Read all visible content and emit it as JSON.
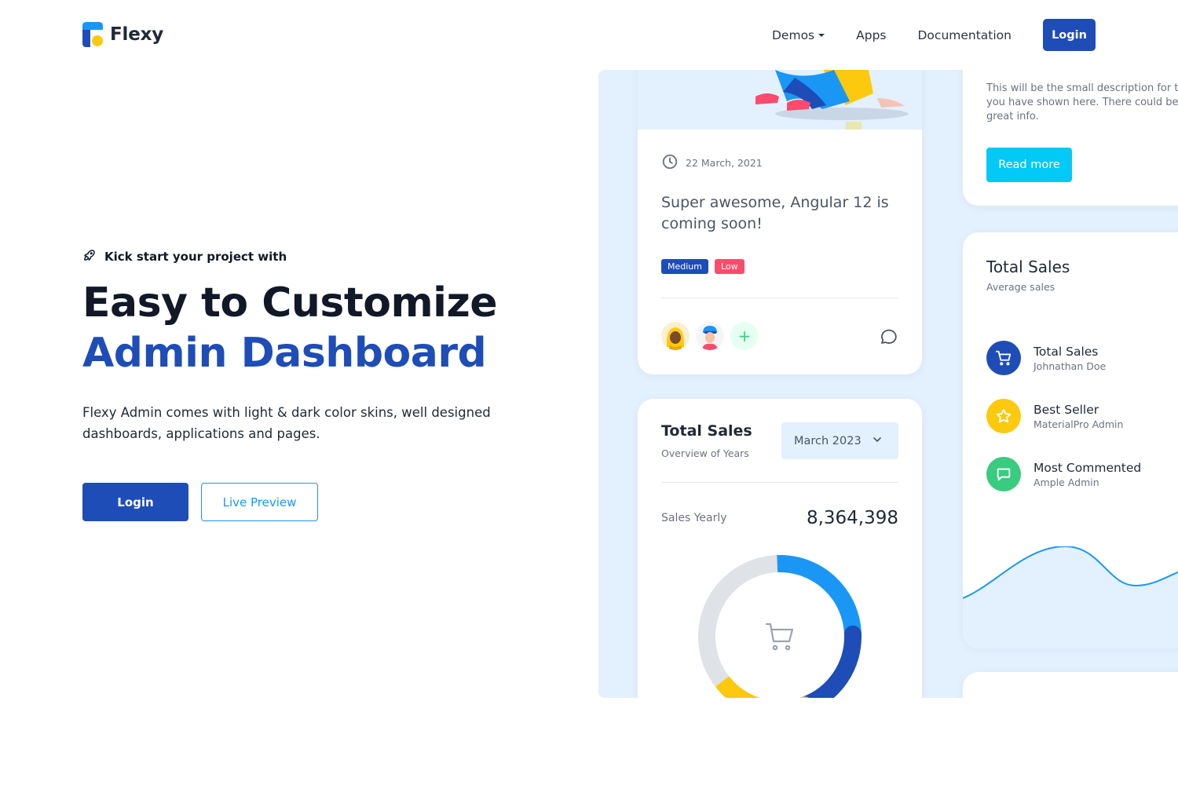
{
  "brand": {
    "name": "Flexy"
  },
  "nav": {
    "demos": "Demos",
    "apps": "Apps",
    "documentation": "Documentation",
    "login": "Login"
  },
  "hero": {
    "kicker": "Kick start your project with",
    "title_line1": "Easy to Customize",
    "title_line2": "Admin Dashboard",
    "description": "Flexy Admin comes with light & dark color skins, well designed dashboards, applications and pages.",
    "login_button": "Login",
    "preview_button": "Live Preview"
  },
  "blog_card": {
    "date": "22 March, 2021",
    "title": "Super awesome, Angular 12 is coming soon!",
    "badges": [
      "Medium",
      "Low"
    ],
    "add_symbol": "+"
  },
  "sales_card": {
    "title": "Total Sales",
    "subtitle": "Overview of Years",
    "selected_month": "March 2023",
    "yearly_label": "Sales Yearly",
    "yearly_value": "8,364,398",
    "donut_shares": [
      {
        "color": "#1a97f5",
        "share": 0.25
      },
      {
        "color": "#1e4db7",
        "share": 0.2
      },
      {
        "color": "#fdc90f",
        "share": 0.2
      },
      {
        "color": "#dfe2e6",
        "share": 0.35
      }
    ]
  },
  "read_card": {
    "description_lines": [
      "This will be the small description for th",
      "you have shown here. There could  be",
      "great info."
    ],
    "button": "Read more"
  },
  "total_sales_panel": {
    "title": "Total Sales",
    "subtitle": "Average sales",
    "items": [
      {
        "name": "Total Sales",
        "meta": "Johnathan Doe",
        "icon": "cart-icon",
        "color": "#1e4db7"
      },
      {
        "name": "Best Seller",
        "meta": "MaterialPro Admin",
        "icon": "star-icon",
        "color": "#fdc90f"
      },
      {
        "name": "Most Commented",
        "meta": "Ample Admin",
        "icon": "message-icon",
        "color": "#39cb7f"
      }
    ]
  },
  "colors": {
    "primary": "#1e4db7",
    "secondary": "#1a97f5",
    "info": "#03c9f6",
    "warning": "#fdc90f",
    "success": "#39cb7f",
    "danger": "#fc4b6c",
    "preview_background": "#e3f0fd"
  }
}
